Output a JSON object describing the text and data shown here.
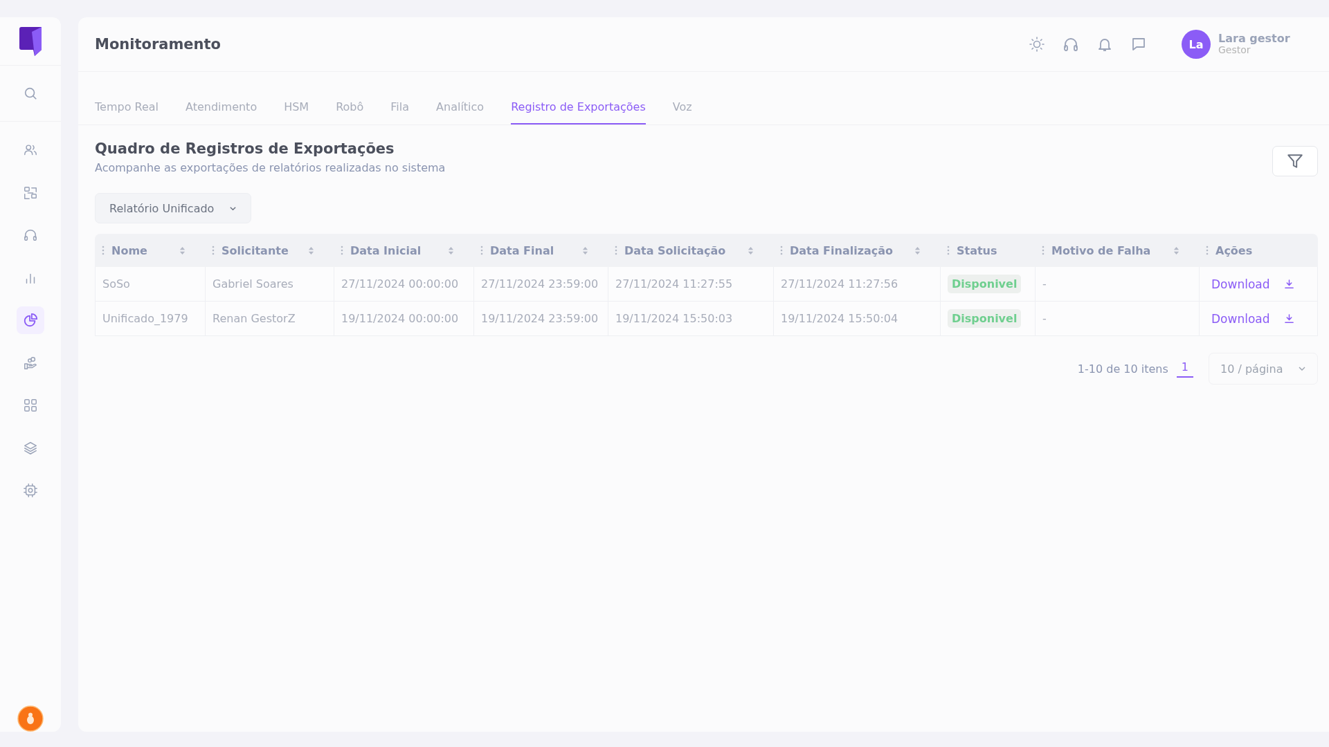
{
  "sidebar": {
    "items": [
      {
        "kind": "users",
        "selected": false
      },
      {
        "kind": "scan",
        "selected": false
      },
      {
        "kind": "headset",
        "selected": false
      },
      {
        "kind": "bars",
        "selected": false
      },
      {
        "kind": "pie",
        "selected": true
      },
      {
        "kind": "hand",
        "selected": false
      },
      {
        "kind": "grid",
        "selected": false
      },
      {
        "kind": "layers",
        "selected": false
      },
      {
        "kind": "chip",
        "selected": false
      }
    ]
  },
  "header": {
    "title": "Monitoramento",
    "user": {
      "initials": "La",
      "name": "Lara gestor",
      "role": "Gestor"
    }
  },
  "tabs": [
    {
      "label": "Tempo Real",
      "selected": false
    },
    {
      "label": "Atendimento",
      "selected": false
    },
    {
      "label": "HSM",
      "selected": false
    },
    {
      "label": "Robô",
      "selected": false
    },
    {
      "label": "Fila",
      "selected": false
    },
    {
      "label": "Analítico",
      "selected": false
    },
    {
      "label": "Registro de Exportações",
      "selected": true
    },
    {
      "label": "Voz",
      "selected": false
    }
  ],
  "section": {
    "title": "Quadro de Registros de Exportações",
    "subtitle": "Acompanhe as exportações de relatórios realizadas no sistema"
  },
  "report_select": {
    "value": "Relatório Unificado"
  },
  "table": {
    "columns": [
      {
        "label": "Nome",
        "sortable": true
      },
      {
        "label": "Solicitante",
        "sortable": true
      },
      {
        "label": "Data Inicial",
        "sortable": true
      },
      {
        "label": "Data Final",
        "sortable": true
      },
      {
        "label": "Data Solicitação",
        "sortable": true
      },
      {
        "label": "Data Finalização",
        "sortable": true
      },
      {
        "label": "Status",
        "sortable": false
      },
      {
        "label": "Motivo de Falha",
        "sortable": true
      },
      {
        "label": "Ações",
        "sortable": false
      }
    ],
    "rows": [
      {
        "cells": [
          "SoSo",
          "Gabriel Soares",
          "27/11/2024 00:00:00",
          "27/11/2024 23:59:00",
          "27/11/2024 11:27:55",
          "27/11/2024 11:27:56"
        ],
        "status": "Disponivel",
        "failure": "-",
        "action": "Download"
      },
      {
        "cells": [
          "Unificado_1979",
          "Renan GestorZ",
          "19/11/2024 00:00:00",
          "19/11/2024 23:59:00",
          "19/11/2024 15:50:03",
          "19/11/2024 15:50:04"
        ],
        "status": "Disponivel",
        "failure": "-",
        "action": "Download"
      }
    ]
  },
  "pagination": {
    "summary": "1-10 de 10 itens",
    "pages": [
      {
        "label": "1",
        "selected": true
      }
    ],
    "page_size": "10 / página"
  }
}
